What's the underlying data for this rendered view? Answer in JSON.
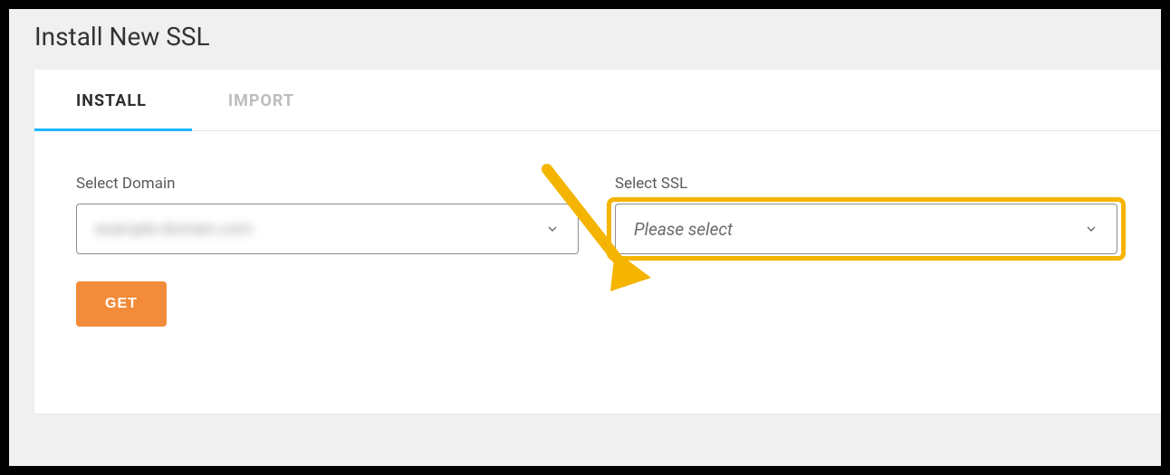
{
  "page": {
    "title": "Install New SSL"
  },
  "tabs": {
    "install": "INSTALL",
    "import": "IMPORT"
  },
  "domain": {
    "label": "Select Domain",
    "value": "example-domain.com"
  },
  "ssl": {
    "label": "Select SSL",
    "placeholder": "Please select"
  },
  "buttons": {
    "get": "GET"
  }
}
